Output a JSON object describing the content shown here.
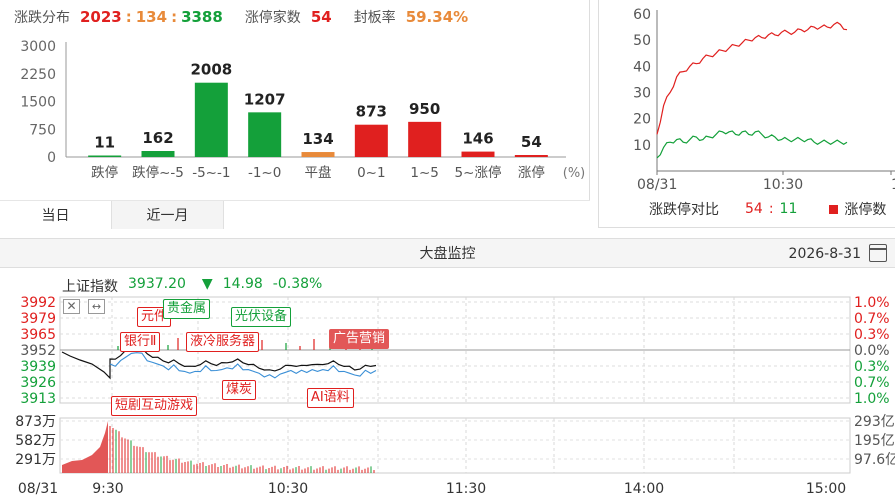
{
  "distribution": {
    "title": "涨跌分布",
    "up_count": "2023",
    "sep1": ":",
    "flat_count": "134",
    "sep2": ":",
    "down_count": "3388",
    "limit_up_label": "涨停家数",
    "limit_up_value": "54",
    "seal_rate_label": "封板率",
    "seal_rate_value": "59.34%"
  },
  "chart_data": [
    {
      "type": "bar",
      "categories": [
        "跌停",
        "跌停~-5",
        "-5~-1",
        "-1~0",
        "平盘",
        "0~1",
        "1~5",
        "5~涨停",
        "涨停"
      ],
      "values": [
        11,
        162,
        2008,
        1207,
        134,
        873,
        950,
        146,
        54
      ],
      "colors": [
        "#14a03a",
        "#14a03a",
        "#14a03a",
        "#14a03a",
        "#e88a3a",
        "#e0201f",
        "#e0201f",
        "#e0201f",
        "#e0201f"
      ],
      "y_ticks": [
        "3000",
        "2250",
        "1500",
        "750",
        "0"
      ],
      "ylim": [
        0,
        3000
      ],
      "x_unit": "(%)"
    },
    {
      "type": "line",
      "y_ticks": [
        "60",
        "50",
        "40",
        "30",
        "20",
        "10"
      ],
      "ylim": [
        0,
        60
      ],
      "x_ticks": [
        "08/31",
        "10:30",
        "1"
      ],
      "legend_label": "涨跌停对比",
      "legend_up": "54",
      "legend_sep": ":",
      "legend_down": "11",
      "legend_marker": "涨停数",
      "series": [
        {
          "color": "#e0201f",
          "values": [
            14,
            25,
            30,
            36,
            38,
            40,
            41,
            43,
            44,
            45,
            46,
            47,
            48,
            49,
            50,
            51,
            51,
            52,
            52,
            53,
            53,
            53,
            54,
            54,
            55,
            55,
            55,
            56,
            56,
            54
          ]
        },
        {
          "color": "#14a03a",
          "values": [
            5,
            9,
            11,
            12,
            11,
            12,
            13,
            12,
            13,
            14,
            15,
            15,
            14,
            15,
            14,
            15,
            14,
            13,
            13,
            12,
            12,
            12,
            12,
            12,
            11,
            11,
            11,
            11,
            11,
            11
          ]
        }
      ]
    },
    {
      "type": "line",
      "y_ticks_left": [
        "3992",
        "3979",
        "3965",
        "3952",
        "3939",
        "3926",
        "3913"
      ],
      "y_ticks_right": [
        "1.0%",
        "0.7%",
        "0.3%",
        "0.0%",
        "0.3%",
        "0.7%",
        "1.0%"
      ],
      "ylim": [
        3913,
        3992
      ],
      "x_ticks": [
        "08/31",
        "9:30",
        "10:30",
        "11:30",
        "14:00",
        "15:00"
      ],
      "vol_ticks_left": [
        "873万",
        "582万",
        "291万"
      ],
      "vol_ticks_right": [
        "293亿",
        "195亿",
        "97.6亿"
      ]
    }
  ],
  "index": {
    "name": "上证指数",
    "price": "3937.20",
    "arrow": "▼",
    "change": "14.98",
    "pct": "-0.38%"
  },
  "tabs": [
    "当日",
    "近一月"
  ],
  "monitor": {
    "title": "大盘监控",
    "date": "2026-8-31"
  },
  "event_tags": [
    {
      "text": "元件",
      "style": "red"
    },
    {
      "text": "贵金属",
      "style": "green"
    },
    {
      "text": "光伏设备",
      "style": "green"
    },
    {
      "text": "银行Ⅱ",
      "style": "red"
    },
    {
      "text": "液冷服务器",
      "style": "red"
    },
    {
      "text": "广告营销",
      "style": "solid"
    },
    {
      "text": "煤炭",
      "style": "red"
    },
    {
      "text": "短剧互动游戏",
      "style": "red"
    },
    {
      "text": "AI语料",
      "style": "red"
    }
  ]
}
